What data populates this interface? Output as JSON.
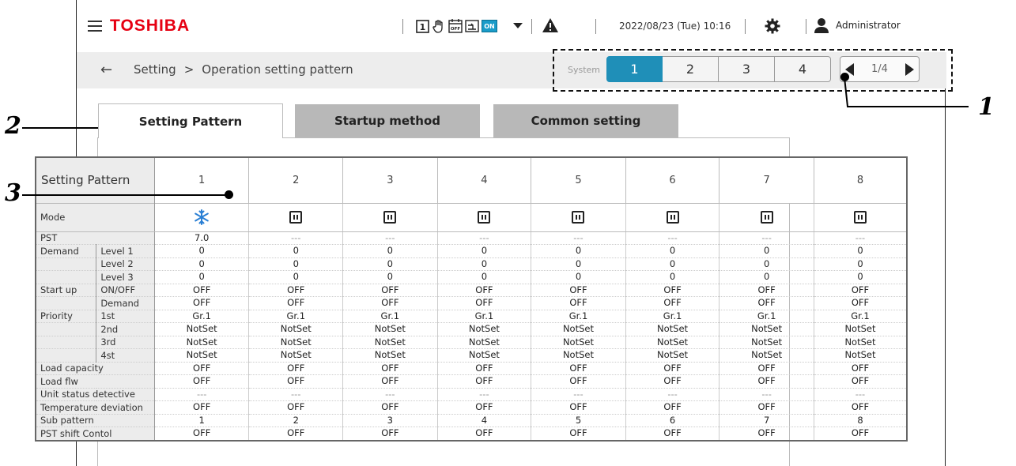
{
  "header": {
    "brand": "TOSHIBA",
    "datetime": "2022/08/23 (Tue) 10:16",
    "user": "Administrator",
    "status_on_badge": "ON",
    "icons": [
      "hamburger-icon",
      "calendar-1-icon",
      "hand-icon",
      "schedule-off-icon",
      "monitor-icon",
      "on-badge-icon",
      "dropdown-icon",
      "warning-icon",
      "gear-icon",
      "user-icon"
    ]
  },
  "breadcrumb": {
    "back": "←",
    "parent": "Setting",
    "separator": ">",
    "current": "Operation setting pattern"
  },
  "system": {
    "label": "System",
    "buttons": [
      "1",
      "2",
      "3",
      "4"
    ],
    "active": 0,
    "page": "1/4"
  },
  "tabs": [
    {
      "label": "Setting Pattern",
      "active": true
    },
    {
      "label": "Startup method",
      "active": false
    },
    {
      "label": "Common setting",
      "active": false
    }
  ],
  "table": {
    "header_label": "Setting Pattern",
    "columns": [
      "1",
      "2",
      "3",
      "4",
      "5",
      "6",
      "7",
      "8"
    ],
    "mode_label": "Mode",
    "modes": [
      "cool",
      "pause",
      "pause",
      "pause",
      "pause",
      "pause",
      "pause",
      "pause"
    ],
    "rows": [
      {
        "group": "PST",
        "sub": "",
        "values": [
          "7.0",
          "---",
          "---",
          "---",
          "---",
          "---",
          "---",
          "---"
        ]
      },
      {
        "group": "Demand",
        "sub": "Level 1",
        "values": [
          "0",
          "0",
          "0",
          "0",
          "0",
          "0",
          "0",
          "0"
        ]
      },
      {
        "group": "",
        "sub": "Level 2",
        "values": [
          "0",
          "0",
          "0",
          "0",
          "0",
          "0",
          "0",
          "0"
        ]
      },
      {
        "group": "",
        "sub": "Level 3",
        "values": [
          "0",
          "0",
          "0",
          "0",
          "0",
          "0",
          "0",
          "0"
        ]
      },
      {
        "group": "Start up",
        "sub": "ON/OFF",
        "values": [
          "OFF",
          "OFF",
          "OFF",
          "OFF",
          "OFF",
          "OFF",
          "OFF",
          "OFF"
        ]
      },
      {
        "group": "",
        "sub": "Demand",
        "values": [
          "OFF",
          "OFF",
          "OFF",
          "OFF",
          "OFF",
          "OFF",
          "OFF",
          "OFF"
        ]
      },
      {
        "group": "Priority",
        "sub": "1st",
        "values": [
          "Gr.1",
          "Gr.1",
          "Gr.1",
          "Gr.1",
          "Gr.1",
          "Gr.1",
          "Gr.1",
          "Gr.1"
        ]
      },
      {
        "group": "",
        "sub": "2nd",
        "values": [
          "NotSet",
          "NotSet",
          "NotSet",
          "NotSet",
          "NotSet",
          "NotSet",
          "NotSet",
          "NotSet"
        ]
      },
      {
        "group": "",
        "sub": "3rd",
        "values": [
          "NotSet",
          "NotSet",
          "NotSet",
          "NotSet",
          "NotSet",
          "NotSet",
          "NotSet",
          "NotSet"
        ]
      },
      {
        "group": "",
        "sub": "4st",
        "values": [
          "NotSet",
          "NotSet",
          "NotSet",
          "NotSet",
          "NotSet",
          "NotSet",
          "NotSet",
          "NotSet"
        ]
      },
      {
        "group": "Load capacity",
        "sub": "",
        "values": [
          "OFF",
          "OFF",
          "OFF",
          "OFF",
          "OFF",
          "OFF",
          "OFF",
          "OFF"
        ]
      },
      {
        "group": "Load flw",
        "sub": "",
        "values": [
          "OFF",
          "OFF",
          "OFF",
          "OFF",
          "OFF",
          "OFF",
          "OFF",
          "OFF"
        ]
      },
      {
        "group": "Unit status detective",
        "sub": "",
        "values": [
          "---",
          "---",
          "---",
          "---",
          "---",
          "---",
          "---",
          "---"
        ]
      },
      {
        "group": "Temperature deviation",
        "sub": "",
        "values": [
          "OFF",
          "OFF",
          "OFF",
          "OFF",
          "OFF",
          "OFF",
          "OFF",
          "OFF"
        ]
      },
      {
        "group": "Sub pattern",
        "sub": "",
        "values": [
          "1",
          "2",
          "3",
          "4",
          "5",
          "6",
          "7",
          "8"
        ]
      },
      {
        "group": "PST shift Contol",
        "sub": "",
        "values": [
          "OFF",
          "OFF",
          "OFF",
          "OFF",
          "OFF",
          "OFF",
          "OFF",
          "OFF"
        ]
      }
    ]
  },
  "callouts": [
    "1",
    "2",
    "3"
  ],
  "colors": {
    "brand": "#e60012",
    "active": "#1f8fb8",
    "cool_icon": "#2a7fd4"
  }
}
